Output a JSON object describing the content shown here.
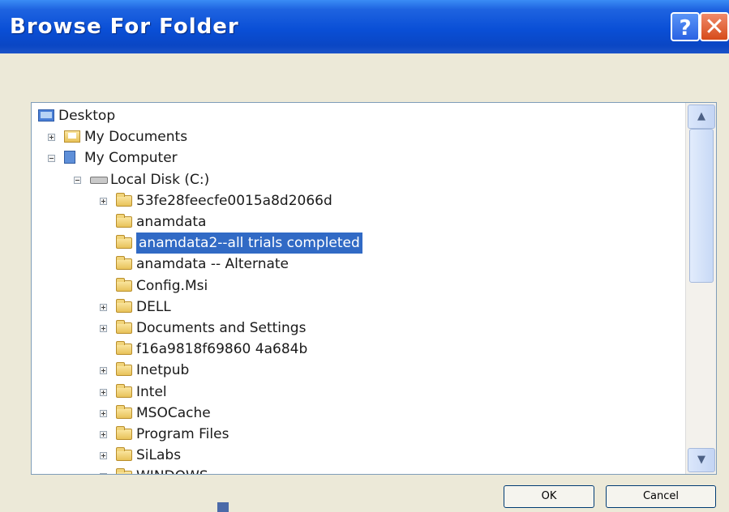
{
  "window": {
    "title": "Browse For Folder",
    "help_label": "?",
    "close_label": "✕"
  },
  "tree": {
    "items": [
      {
        "label": "Desktop",
        "icon": "desktop-icon",
        "expander": "none",
        "level": 0
      },
      {
        "label": "My Documents",
        "icon": "my-documents-icon",
        "expander": "plus",
        "level": 1
      },
      {
        "label": "My Computer",
        "icon": "my-computer-icon",
        "expander": "minus",
        "level": 1
      },
      {
        "label": "Local Disk (C:)",
        "icon": "local-disk-icon",
        "expander": "minus",
        "level": 2
      },
      {
        "label": "53fe28feecfe0015a8d2066d",
        "icon": "folder-icon",
        "expander": "plus",
        "level": 3
      },
      {
        "label": "anamdata",
        "icon": "folder-icon",
        "expander": "none",
        "level": 3
      },
      {
        "label": "anamdata2--all trials completed",
        "icon": "folder-icon",
        "expander": "none",
        "level": 3,
        "selected": true
      },
      {
        "label": "anamdata -- Alternate",
        "icon": "folder-icon",
        "expander": "none",
        "level": 3
      },
      {
        "label": "Config.Msi",
        "icon": "folder-icon",
        "expander": "none",
        "level": 3
      },
      {
        "label": "DELL",
        "icon": "folder-icon",
        "expander": "plus",
        "level": 3
      },
      {
        "label": "Documents and Settings",
        "icon": "folder-icon",
        "expander": "plus",
        "level": 3
      },
      {
        "label": "f16a9818f69860 4a684b",
        "icon": "folder-icon",
        "expander": "none",
        "level": 3
      },
      {
        "label": "Inetpub",
        "icon": "folder-icon",
        "expander": "plus",
        "level": 3
      },
      {
        "label": "Intel",
        "icon": "folder-icon",
        "expander": "plus",
        "level": 3
      },
      {
        "label": "MSOCache",
        "icon": "folder-icon",
        "expander": "plus",
        "level": 3
      },
      {
        "label": "Program Files",
        "icon": "folder-icon",
        "expander": "plus",
        "level": 3
      },
      {
        "label": "SiLabs",
        "icon": "folder-icon",
        "expander": "plus",
        "level": 3
      },
      {
        "label": "WINDOWS",
        "icon": "folder-icon",
        "expander": "plus",
        "level": 3
      }
    ]
  },
  "scrollbar": {
    "up_arrow": "▲",
    "down_arrow": "▼"
  },
  "buttons": {
    "ok_label": "OK",
    "cancel_label": "Cancel"
  },
  "colors": {
    "titlebar": "#0a4fd6",
    "selection": "#316ac5",
    "dialog_bg": "#ece9d8"
  }
}
